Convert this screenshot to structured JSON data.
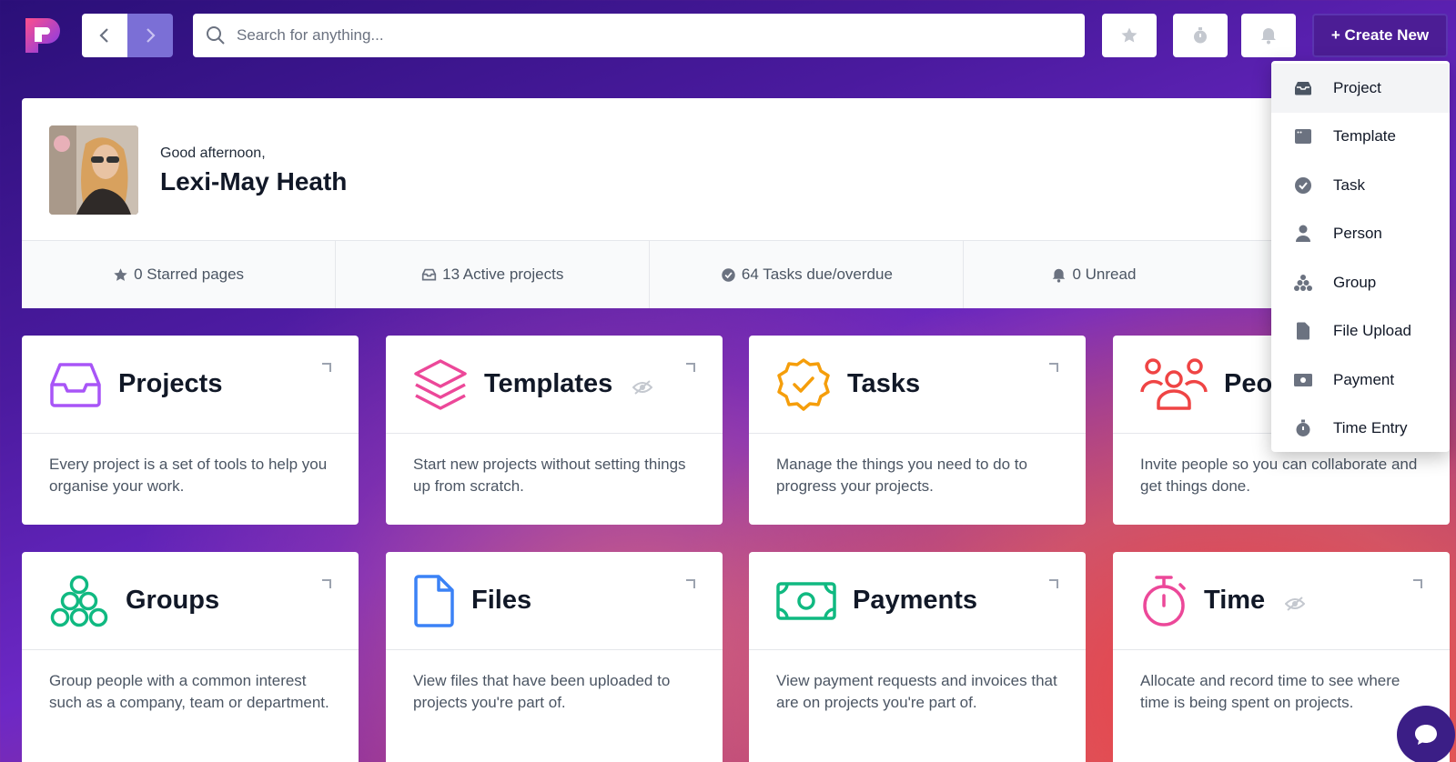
{
  "topbar": {
    "search_placeholder": "Search for anything...",
    "create_label": "+ Create New"
  },
  "welcome": {
    "greeting": "Good afternoon,",
    "name": "Lexi-May Heath",
    "stats": [
      {
        "label": "0 Starred pages",
        "icon": "star-icon"
      },
      {
        "label": "13 Active projects",
        "icon": "inbox-icon"
      },
      {
        "label": "64 Tasks due/overdue",
        "icon": "check-badge-icon"
      },
      {
        "label": "0 Unread",
        "icon": "bell-icon"
      }
    ]
  },
  "tiles": [
    {
      "title": "Projects",
      "desc": "Every project is a set of tools to help you organise your work.",
      "icon": "inbox-icon",
      "color": "#a855f7"
    },
    {
      "title": "Templates",
      "desc": "Start new projects without setting things up from scratch.",
      "icon": "layers-icon",
      "color": "#ec4899",
      "hidden": true
    },
    {
      "title": "Tasks",
      "desc": "Manage the things you need to do to progress your projects.",
      "icon": "check-badge-icon",
      "color": "#f59e0b"
    },
    {
      "title": "Peo",
      "desc": "Invite people so you can collaborate and get things done.",
      "icon": "people-icon",
      "color": "#ef4444"
    },
    {
      "title": "Groups",
      "desc": "Group people with a common interest such as a company, team or department.",
      "icon": "circles-icon",
      "color": "#10b981"
    },
    {
      "title": "Files",
      "desc": "View files that have been uploaded to projects you're part of.",
      "icon": "file-icon",
      "color": "#3b82f6"
    },
    {
      "title": "Payments",
      "desc": "View payment requests and invoices that are on projects you're part of.",
      "icon": "cash-icon",
      "color": "#10b981"
    },
    {
      "title": "Time",
      "desc": "Allocate and record time to see where time is being spent on projects.",
      "icon": "stopwatch-icon",
      "color": "#ec4899",
      "hidden": true
    }
  ],
  "dropdown": {
    "items": [
      {
        "label": "Project",
        "icon": "inbox-icon"
      },
      {
        "label": "Template",
        "icon": "window-icon"
      },
      {
        "label": "Task",
        "icon": "check-badge-icon"
      },
      {
        "label": "Person",
        "icon": "person-icon"
      },
      {
        "label": "Group",
        "icon": "circles-icon"
      },
      {
        "label": "File Upload",
        "icon": "file-icon"
      },
      {
        "label": "Payment",
        "icon": "cash-icon"
      },
      {
        "label": "Time Entry",
        "icon": "stopwatch-icon"
      }
    ]
  }
}
